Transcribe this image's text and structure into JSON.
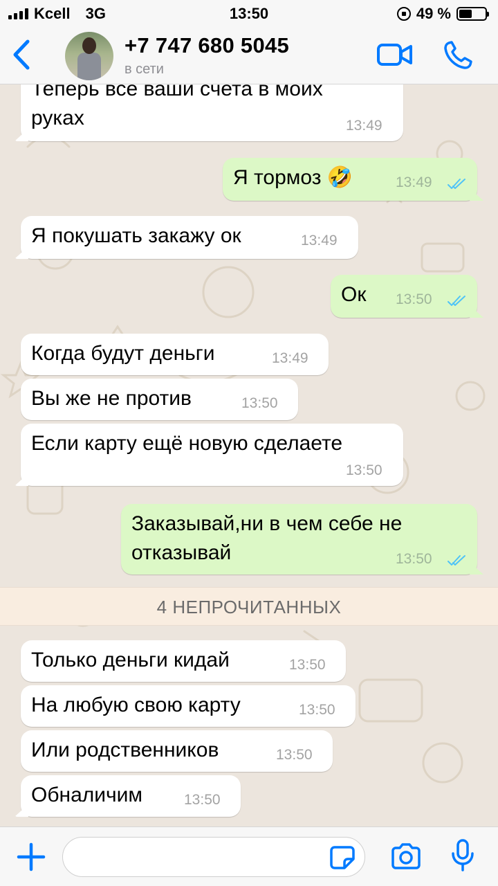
{
  "status_bar": {
    "carrier": "Kcell",
    "network": "3G",
    "time": "13:50",
    "battery": "49 %",
    "battery_level": 0.49
  },
  "header": {
    "contact_name": "+7 747 680 5045",
    "contact_status": "в сети",
    "back_icon": "chevron-left-icon",
    "video_icon": "video-camera-icon",
    "phone_icon": "phone-icon"
  },
  "messages": [
    {
      "dir": "in",
      "lines": [
        "Теперь все ваши счета в моих",
        "руках"
      ],
      "time": "13:49"
    },
    {
      "dir": "out",
      "lines": [
        "Я тормоз 🤣"
      ],
      "time": "13:49",
      "read": true
    },
    {
      "dir": "in",
      "lines": [
        "Я покушать закажу ок"
      ],
      "time": "13:49"
    },
    {
      "dir": "out",
      "lines": [
        "Ок"
      ],
      "time": "13:50",
      "read": true
    },
    {
      "dir": "in",
      "lines": [
        "Когда будут деньги"
      ],
      "time": "13:49"
    },
    {
      "dir": "in",
      "lines": [
        "Вы же не против"
      ],
      "time": "13:50"
    },
    {
      "dir": "in",
      "lines": [
        "Если карту ещё новую сделаете"
      ],
      "time": "13:50"
    },
    {
      "dir": "out",
      "lines": [
        "Заказывай,ни в чем себе не",
        "отказывай"
      ],
      "time": "13:50",
      "read": true
    },
    {
      "dir": "in",
      "lines": [
        "Только деньги кидай"
      ],
      "time": "13:50"
    },
    {
      "dir": "in",
      "lines": [
        "На любую свою карту"
      ],
      "time": "13:50"
    },
    {
      "dir": "in",
      "lines": [
        "Или родственников"
      ],
      "time": "13:50"
    },
    {
      "dir": "in",
      "lines": [
        "Обналичим"
      ],
      "time": "13:50"
    }
  ],
  "unread_banner": "4 НЕПРОЧИТАННЫХ",
  "input": {
    "value": "",
    "plus_icon": "plus-icon",
    "sticker_icon": "sticker-icon",
    "camera_icon": "camera-icon",
    "mic_icon": "microphone-icon"
  },
  "colors": {
    "accent": "#007aff",
    "incoming_bubble": "#ffffff",
    "outgoing_bubble": "#dcf8c6",
    "read_check": "#4fc3f7",
    "chat_background": "#ece5dd",
    "unread_banner": "#f9ede0"
  }
}
